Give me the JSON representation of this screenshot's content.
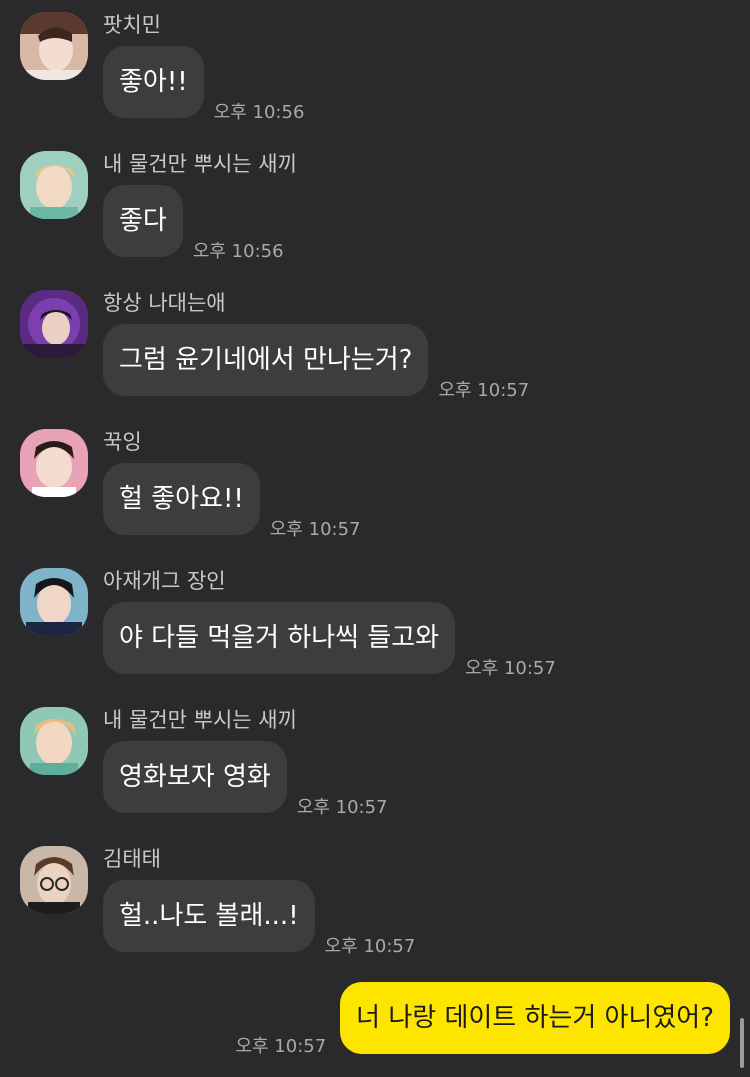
{
  "colors": {
    "background": "#2a2a2c",
    "incoming_bubble": "#3d3d40",
    "outgoing_bubble": "#fee500",
    "sender_text": "#c8c8ca",
    "time_text": "#a9a9ab"
  },
  "messages": [
    {
      "sender": "팟치민",
      "text": "좋아!!",
      "time": "오후 10:56",
      "avatar": "profile-photo-icon"
    },
    {
      "sender": "내 물건만 뿌시는 새끼",
      "text": "좋다",
      "time": "오후 10:56",
      "avatar": "profile-photo-icon"
    },
    {
      "sender": "항상 나대는애",
      "text": "그럼 윤기네에서 만나는거?",
      "time": "오후 10:57",
      "avatar": "profile-photo-icon"
    },
    {
      "sender": "꾹잉",
      "text": "헐 좋아요!!",
      "time": "오후 10:57",
      "avatar": "profile-photo-icon"
    },
    {
      "sender": "아재개그 장인",
      "text": "야 다들 먹을거 하나씩 들고와",
      "time": "오후 10:57",
      "avatar": "profile-photo-icon"
    },
    {
      "sender": "내 물건만 뿌시는 새끼",
      "text": "영화보자 영화",
      "time": "오후 10:57",
      "avatar": "profile-photo-icon"
    },
    {
      "sender": "김태태",
      "text": "헐..나도 볼래...!",
      "time": "오후 10:57",
      "avatar": "profile-photo-icon"
    }
  ],
  "my_message": {
    "text": "너 나랑 데이트 하는거 아니였어?",
    "time": "오후 10:57"
  }
}
